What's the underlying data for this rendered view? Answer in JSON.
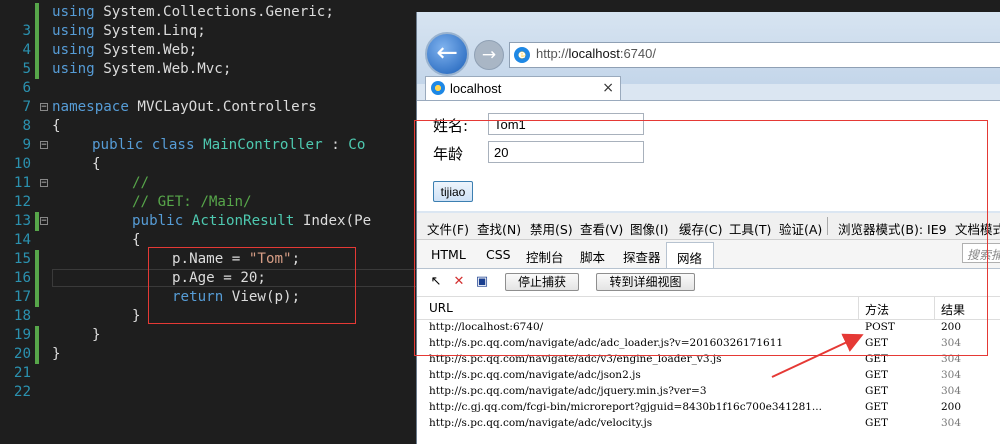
{
  "editor": {
    "lines": [
      {
        "num": "3"
      },
      {
        "num": "4"
      },
      {
        "num": "5"
      },
      {
        "num": "6"
      },
      {
        "num": "7"
      },
      {
        "num": "8"
      },
      {
        "num": "9"
      },
      {
        "num": "10"
      },
      {
        "num": "11"
      },
      {
        "num": "12"
      },
      {
        "num": "13"
      },
      {
        "num": "14"
      },
      {
        "num": "15"
      },
      {
        "num": "16"
      },
      {
        "num": "17"
      },
      {
        "num": "18"
      },
      {
        "num": "19"
      },
      {
        "num": "20"
      },
      {
        "num": "21"
      },
      {
        "num": "22"
      }
    ],
    "code": {
      "kw_using": "using",
      "ns_generic": "System.Collections.Generic;",
      "ns_linq": "System.Linq;",
      "ns_web": "System.Web;",
      "ns_mvc": "System.Web.Mvc;",
      "kw_namespace": "namespace",
      "ns_name": "MVCLayOut.Controllers",
      "brace_open": "{",
      "brace_close": "}",
      "kw_public": "public",
      "kw_class": "class",
      "class_name": "MainController",
      "class_colon": " : ",
      "class_base": "Co",
      "comment_slash": "//",
      "comment_route": "// GET: /Main/",
      "ret_type": "ActionResult",
      "method_sig": "Index(Pe",
      "stmt_name_lhs": "p.Name = ",
      "stmt_name_val": "\"Tom\"",
      "stmt_semicolon": ";",
      "stmt_age": "p.Age = 20;",
      "kw_return": "return",
      "stmt_view": "View(p);"
    }
  },
  "browser": {
    "address_prefix": "http://",
    "address_host": "localhost",
    "address_suffix": ":6740/",
    "tab_title": "localhost",
    "tab_close": "×",
    "form": {
      "name_label": "姓名:",
      "name_value": "Tom1",
      "age_label": "年龄",
      "age_value": "20",
      "submit_label": "tijiao"
    }
  },
  "devtools": {
    "menu": [
      "文件(F)",
      "查找(N)",
      "禁用(S)",
      "查看(V)",
      "图像(I)",
      "缓存(C)",
      "工具(T)",
      "验证(A)"
    ],
    "browser_mode": "浏览器模式(B): IE9",
    "doc_mode": "文档模式",
    "tabs": [
      "HTML",
      "CSS",
      "控制台",
      "脚本",
      "探查器"
    ],
    "active_tab": "网络",
    "search_placeholder": "搜索捕",
    "toolbar": {
      "stop_label": "停止捕获",
      "detail_label": "转到详细视图"
    },
    "table": {
      "headers": {
        "url": "URL",
        "method": "方法",
        "result": "结果"
      },
      "rows": [
        {
          "url": "http://localhost:6740/",
          "method": "POST",
          "result": "200"
        },
        {
          "url": "http://s.pc.qq.com/navigate/adc/adc_loader.js?v=20160326171611",
          "method": "GET",
          "result": "304"
        },
        {
          "url": "http://s.pc.qq.com/navigate/adc/v3/engine_loader_v3.js",
          "method": "GET",
          "result": "304"
        },
        {
          "url": "http://s.pc.qq.com/navigate/adc/json2.js",
          "method": "GET",
          "result": "304"
        },
        {
          "url": "http://s.pc.qq.com/navigate/adc/jquery.min.js?ver=3",
          "method": "GET",
          "result": "304"
        },
        {
          "url": "http://c.gj.qq.com/fcgi-bin/microreport?gjguid=8430b1f16c700e341281...",
          "method": "GET",
          "result": "200"
        },
        {
          "url": "http://s.pc.qq.com/navigate/adc/velocity.js",
          "method": "GET",
          "result": "304"
        }
      ]
    }
  },
  "colors": {
    "highlight": "#e53935",
    "keyword": "#569cd6",
    "type": "#4ec9b0",
    "comment": "#57a64a",
    "string": "#d69d85"
  }
}
